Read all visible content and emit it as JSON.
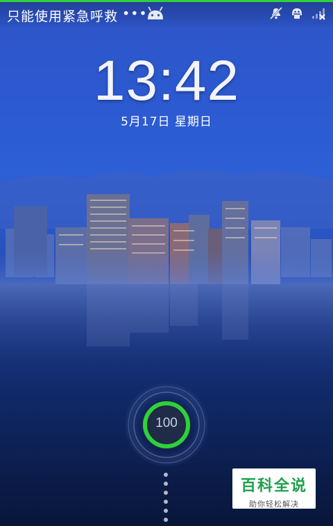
{
  "status_bar": {
    "carrier_text": "只能使用紧急呼救",
    "more_indicator": "•••",
    "icons": [
      "android-icon",
      "mute-icon",
      "usb-debug-icon",
      "no-signal-icon"
    ],
    "charge_progress": 1.0,
    "progress_color": "#2fd13a"
  },
  "lockscreen": {
    "time": "13:42",
    "date": "5月17日 星期日"
  },
  "unlock_ring": {
    "battery_level": "100",
    "ring_color": "#2fd13a"
  },
  "watermark": {
    "title": "百科全说",
    "subtitle": "助你轻松解决"
  }
}
